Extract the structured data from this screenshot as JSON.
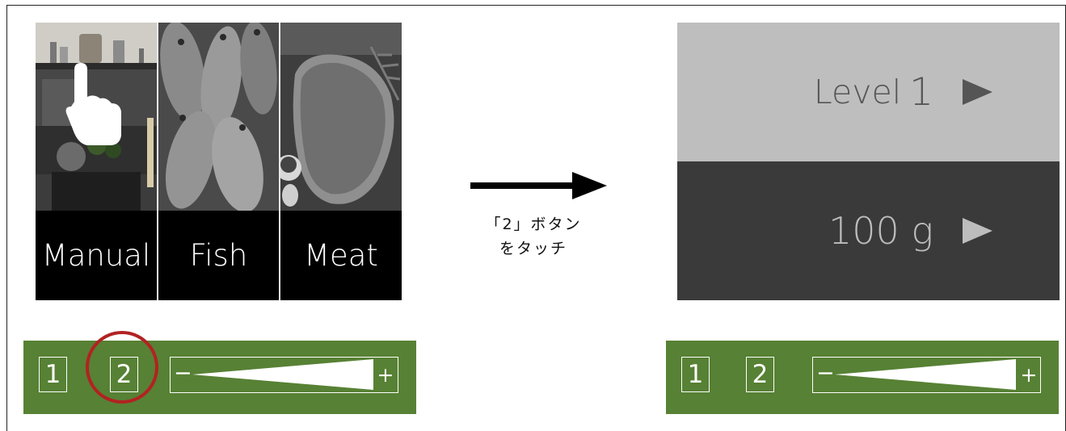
{
  "before": {
    "categories": [
      {
        "label": "Manual",
        "photo": "kitchen-photo"
      },
      {
        "label": "Fish",
        "photo": "fish-photo"
      },
      {
        "label": "Meat",
        "photo": "steak-photo"
      }
    ],
    "gesture_icon": "hand-tap-icon",
    "controls": {
      "button_1": "1",
      "button_2": "2",
      "minus": "−",
      "plus": "+"
    }
  },
  "transition": {
    "line1": "「2」ボタン",
    "line2": "をタッチ",
    "icon": "right-arrow-icon"
  },
  "after": {
    "level_label": "Level",
    "level_value": "1",
    "weight_label": "100 g",
    "controls": {
      "button_1": "1",
      "button_2": "2",
      "minus": "−",
      "plus": "+"
    }
  },
  "colors": {
    "bar_green": "#578134",
    "highlight_ring": "#b22222",
    "level_row": "#bebebe",
    "weight_row": "#3a3a3a"
  }
}
